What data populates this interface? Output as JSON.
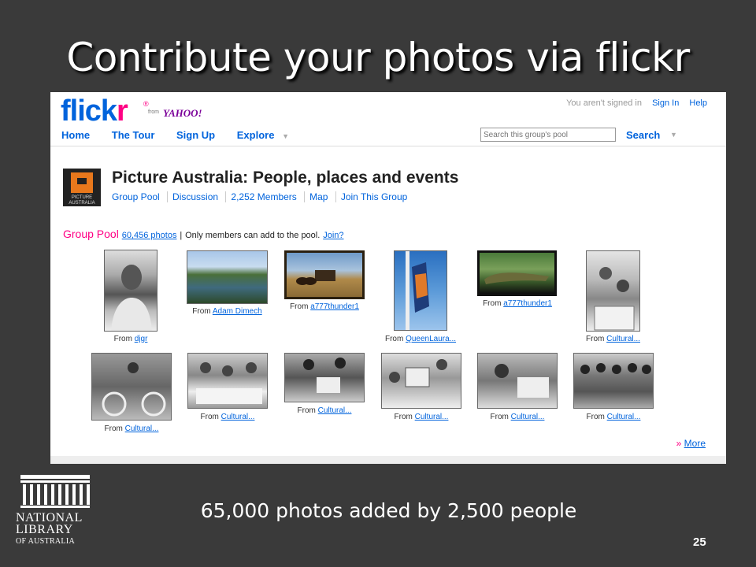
{
  "slide": {
    "title": "Contribute your photos via flickr",
    "footer": "65,000 photos added by 2,500 people",
    "page_number": "25",
    "logo": {
      "line1": "NATIONAL",
      "line2": "LIBRARY",
      "line3": "OF AUSTRALIA"
    }
  },
  "flickr": {
    "logo_text_a": "flick",
    "logo_text_b": "r",
    "logo_reg": "®",
    "from": "from",
    "yahoo": "YAHOO!",
    "signin_status": "You aren't signed in",
    "signin_link": "Sign In",
    "help_link": "Help",
    "nav": [
      "Home",
      "The Tour",
      "Sign Up",
      "Explore"
    ],
    "search_placeholder": "Search this group's pool",
    "search_button": "Search",
    "group_icon_text": "PICTURE AUSTRALIA",
    "group_title": "Picture Australia: People, places and events",
    "group_links": [
      "Group Pool",
      "Discussion",
      "2,252 Members",
      "Map",
      "Join This Group"
    ],
    "pool_heading": "Group Pool",
    "pool_count": "60,456 photos",
    "pool_sep": "|",
    "pool_note": "Only members can add to the pool.",
    "pool_join": "Join?",
    "from_label": "From",
    "photos": [
      {
        "author": "djgr"
      },
      {
        "author": "Adam Dimech"
      },
      {
        "author": "a777thunder1"
      },
      {
        "author": "QueenLaura..."
      },
      {
        "author": "a777thunder1"
      },
      {
        "author": "Cultural..."
      },
      {
        "author": "Cultural..."
      },
      {
        "author": "Cultural..."
      },
      {
        "author": "Cultural..."
      },
      {
        "author": "Cultural..."
      },
      {
        "author": "Cultural..."
      },
      {
        "author": "Cultural..."
      }
    ],
    "more_raquo": "»",
    "more": "More"
  },
  "colors": {
    "flickr_blue": "#0063dc",
    "flickr_pink": "#ff0084",
    "slide_bg": "#3a3a3a"
  }
}
